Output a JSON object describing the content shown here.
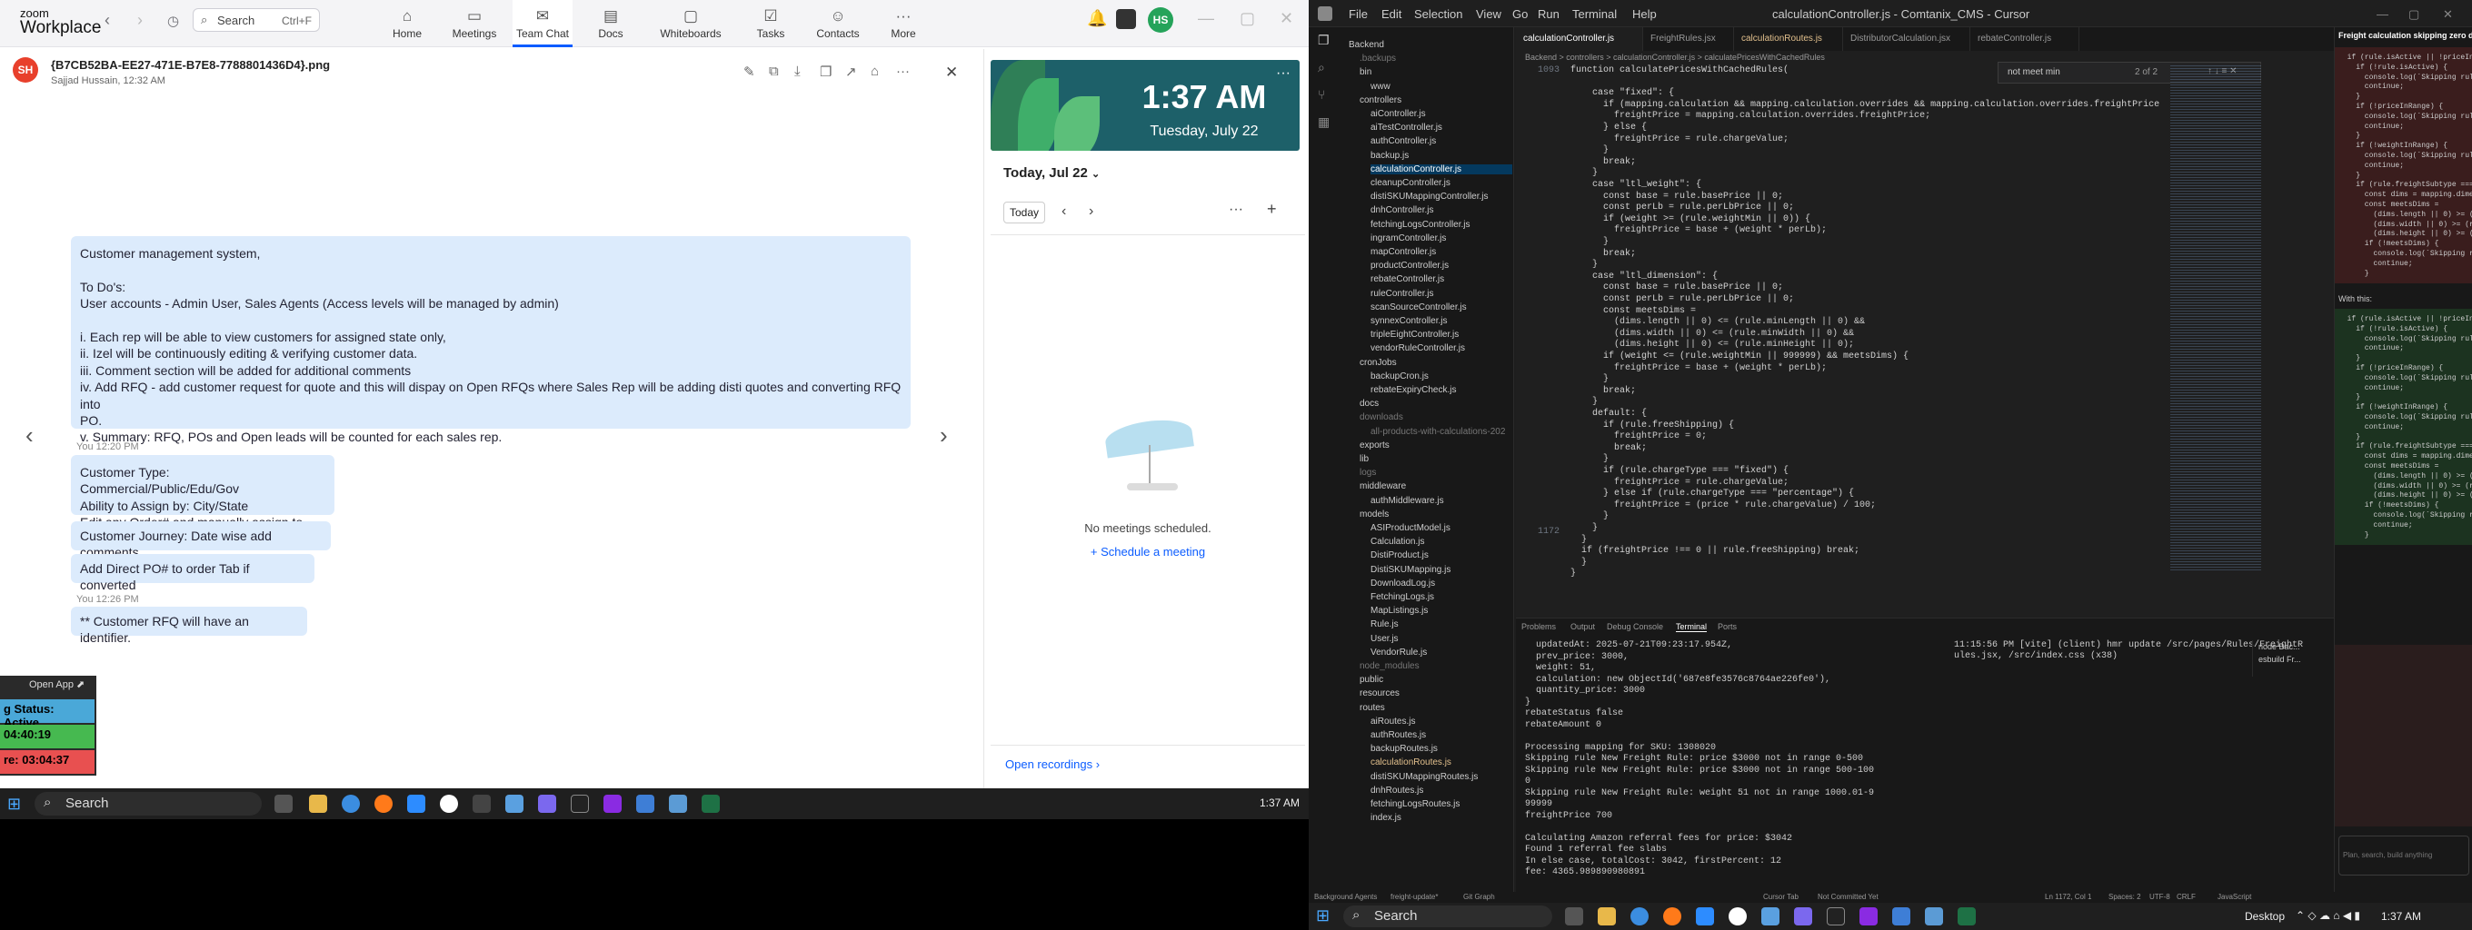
{
  "zoom": {
    "logo_top": "zoom",
    "logo_bottom": "Workplace",
    "search_placeholder": "Search",
    "search_shortcut": "Ctrl+F",
    "tabs": [
      {
        "label": "Home",
        "icon": "home-icon"
      },
      {
        "label": "Meetings",
        "icon": "video-icon"
      },
      {
        "label": "Team Chat",
        "icon": "chat-icon"
      },
      {
        "label": "Docs",
        "icon": "doc-icon"
      },
      {
        "label": "Whiteboards",
        "icon": "whiteboard-icon"
      },
      {
        "label": "Tasks",
        "icon": "tasks-icon"
      },
      {
        "label": "Contacts",
        "icon": "contacts-icon"
      },
      {
        "label": "More",
        "icon": "more-icon"
      }
    ],
    "active_tab": "Team Chat",
    "user_initials": "HS"
  },
  "file_viewer": {
    "sender_initials": "SH",
    "file_name": "{B7CB52BA-EE27-471E-B7E8-7788801436D4}.png",
    "subtitle": "Sajjad Hussain, 12:32 AM"
  },
  "messages": {
    "main_lines": [
      "Customer management system,",
      "",
      "To Do's:",
      "User accounts - Admin User, Sales Agents (Access levels will be managed by admin)",
      "",
      "i. Each rep will be able to view customers for assigned state only,",
      "ii. Izel will be continuously editing & verifying customer data.",
      "iii. Comment section will be added for additional comments",
      "iv. Add RFQ - add customer request for quote and this will dispay on Open RFQs where Sales Rep will be adding disti quotes and converting RFQ into",
      "PO.",
      "v. Summary: RFQ, POs and Open leads will be counted for each sales rep."
    ],
    "meta1": "You 12:20 PM",
    "block2": [
      "Customer Type: Commercial/Public/Edu/Gov",
      "Ability to Assign by: City/State",
      "Edit any Order# and manually assign to Rep"
    ],
    "single1": "Customer Journey: Date wise add comments",
    "single2": "Add Direct PO# to order Tab if converted",
    "meta2": "You 12:26 PM",
    "single3": "** Customer RFQ will have an identifier."
  },
  "calendar": {
    "time": "1:37 AM",
    "date": "Tuesday, July 22",
    "today_label": "Today, Jul 22",
    "today_button": "Today",
    "empty_text": "No meetings scheduled.",
    "schedule_link": "Schedule a meeting",
    "recordings_link": "Open recordings"
  },
  "status_widget": {
    "open_app": "Open App",
    "status": "g Status: Active",
    "timer1": "04:40:19",
    "timer2": "re: 03:04:37"
  },
  "taskbar_left": {
    "search": "Search",
    "time": "1:37 AM"
  },
  "vscode": {
    "menus": [
      "File",
      "Edit",
      "Selection",
      "View",
      "Go",
      "Run",
      "Terminal",
      "Help"
    ],
    "window_title": "calculationController.js - Comtanix_CMS - Cursor",
    "tabs": [
      "calculationController.js",
      "FreightRules.jsx",
      "calculationRoutes.js",
      "DistributorCalculation.jsx",
      "rebateController.js"
    ],
    "breadcrumb": "Backend > controllers > calculationController.js > calculatePricesWithCachedRules",
    "find_text": "not meet min",
    "find_count": "2 of 2",
    "explorer": [
      {
        "t": "Backend",
        "d": 0,
        "c": "folder"
      },
      {
        "t": ".backups",
        "d": 1,
        "c": "dim"
      },
      {
        "t": "bin",
        "d": 1,
        "c": ""
      },
      {
        "t": "www",
        "d": 2,
        "c": ""
      },
      {
        "t": "controllers",
        "d": 1,
        "c": ""
      },
      {
        "t": "aiController.js",
        "d": 2,
        "c": ""
      },
      {
        "t": "aiTestController.js",
        "d": 2,
        "c": ""
      },
      {
        "t": "authController.js",
        "d": 2,
        "c": ""
      },
      {
        "t": "backup.js",
        "d": 2,
        "c": ""
      },
      {
        "t": "calculationController.js",
        "d": 2,
        "c": "sel"
      },
      {
        "t": "cleanupController.js",
        "d": 2,
        "c": ""
      },
      {
        "t": "distiSKUMappingController.js",
        "d": 2,
        "c": ""
      },
      {
        "t": "dnhController.js",
        "d": 2,
        "c": ""
      },
      {
        "t": "fetchingLogsController.js",
        "d": 2,
        "c": ""
      },
      {
        "t": "ingramController.js",
        "d": 2,
        "c": ""
      },
      {
        "t": "mapController.js",
        "d": 2,
        "c": ""
      },
      {
        "t": "productController.js",
        "d": 2,
        "c": ""
      },
      {
        "t": "rebateController.js",
        "d": 2,
        "c": ""
      },
      {
        "t": "ruleController.js",
        "d": 2,
        "c": ""
      },
      {
        "t": "scanSourceController.js",
        "d": 2,
        "c": ""
      },
      {
        "t": "synnexController.js",
        "d": 2,
        "c": ""
      },
      {
        "t": "tripleEightController.js",
        "d": 2,
        "c": ""
      },
      {
        "t": "vendorRuleController.js",
        "d": 2,
        "c": ""
      },
      {
        "t": "cronJobs",
        "d": 1,
        "c": ""
      },
      {
        "t": "backupCron.js",
        "d": 2,
        "c": ""
      },
      {
        "t": "rebateExpiryCheck.js",
        "d": 2,
        "c": ""
      },
      {
        "t": "docs",
        "d": 1,
        "c": ""
      },
      {
        "t": "downloads",
        "d": 1,
        "c": "dim"
      },
      {
        "t": "all-products-with-calculations-202",
        "d": 2,
        "c": "dim"
      },
      {
        "t": "exports",
        "d": 1,
        "c": ""
      },
      {
        "t": "lib",
        "d": 1,
        "c": ""
      },
      {
        "t": "logs",
        "d": 1,
        "c": "dim"
      },
      {
        "t": "middleware",
        "d": 1,
        "c": ""
      },
      {
        "t": "authMiddleware.js",
        "d": 2,
        "c": ""
      },
      {
        "t": "models",
        "d": 1,
        "c": ""
      },
      {
        "t": "ASIProductModel.js",
        "d": 2,
        "c": ""
      },
      {
        "t": "Calculation.js",
        "d": 2,
        "c": ""
      },
      {
        "t": "DistiProduct.js",
        "d": 2,
        "c": ""
      },
      {
        "t": "DistiSKUMapping.js",
        "d": 2,
        "c": ""
      },
      {
        "t": "DownloadLog.js",
        "d": 2,
        "c": ""
      },
      {
        "t": "FetchingLogs.js",
        "d": 2,
        "c": ""
      },
      {
        "t": "MapListings.js",
        "d": 2,
        "c": ""
      },
      {
        "t": "Rule.js",
        "d": 2,
        "c": ""
      },
      {
        "t": "User.js",
        "d": 2,
        "c": ""
      },
      {
        "t": "VendorRule.js",
        "d": 2,
        "c": ""
      },
      {
        "t": "node_modules",
        "d": 1,
        "c": "dim"
      },
      {
        "t": "public",
        "d": 1,
        "c": ""
      },
      {
        "t": "resources",
        "d": 1,
        "c": ""
      },
      {
        "t": "routes",
        "d": 1,
        "c": ""
      },
      {
        "t": "aiRoutes.js",
        "d": 2,
        "c": ""
      },
      {
        "t": "authRoutes.js",
        "d": 2,
        "c": ""
      },
      {
        "t": "backupRoutes.js",
        "d": 2,
        "c": ""
      },
      {
        "t": "calculationRoutes.js",
        "d": 2,
        "c": "mod"
      },
      {
        "t": "distiSKUMappingRoutes.js",
        "d": 2,
        "c": ""
      },
      {
        "t": "dnhRoutes.js",
        "d": 2,
        "c": ""
      },
      {
        "t": "fetchingLogsRoutes.js",
        "d": 2,
        "c": ""
      },
      {
        "t": "index.js",
        "d": 2,
        "c": ""
      }
    ],
    "line_numbers": [
      "1093",
      "",
      "",
      "",
      "",
      "",
      "",
      "",
      "",
      "",
      "",
      "",
      "",
      "",
      "",
      "",
      "",
      "",
      "",
      "",
      "",
      "",
      "",
      "",
      "",
      "",
      "",
      "",
      "",
      "",
      "",
      "",
      "",
      "",
      "",
      "",
      "",
      "",
      "",
      "",
      "",
      "",
      "",
      "",
      "",
      "",
      "",
      "",
      "",
      "",
      "",
      "",
      "",
      "1172"
    ],
    "code": [
      "function calculatePricesWithCachedRules(",
      "",
      "    case \"fixed\": {",
      "      if (mapping.calculation && mapping.calculation.overrides && mapping.calculation.overrides.freightPrice",
      "        freightPrice = mapping.calculation.overrides.freightPrice;",
      "      } else {",
      "        freightPrice = rule.chargeValue;",
      "      }",
      "      break;",
      "    }",
      "    case \"ltl_weight\": {",
      "      const base = rule.basePrice || 0;",
      "      const perLb = rule.perLbPrice || 0;",
      "      if (weight >= (rule.weightMin || 0)) {",
      "        freightPrice = base + (weight * perLb);",
      "      }",
      "      break;",
      "    }",
      "    case \"ltl_dimension\": {",
      "      const base = rule.basePrice || 0;",
      "      const perLb = rule.perLbPrice || 0;",
      "      const meetsDims =",
      "        (dims.length || 0) <= (rule.minLength || 0) &&",
      "        (dims.width || 0) <= (rule.minWidth || 0) &&",
      "        (dims.height || 0) <= (rule.minHeight || 0);",
      "      if (weight <= (rule.weightMin || 999999) && meetsDims) {",
      "        freightPrice = base + (weight * perLb);",
      "      }",
      "      break;",
      "    }",
      "    default: {",
      "      if (rule.freeShipping) {",
      "        freightPrice = 0;",
      "        break;",
      "      }",
      "      if (rule.chargeType === \"fixed\") {",
      "        freightPrice = rule.chargeValue;",
      "      } else if (rule.chargeType === \"percentage\") {",
      "        freightPrice = (price * rule.chargeValue) / 100;",
      "      }",
      "    }",
      "  }",
      "  if (freightPrice !== 0 || rule.freeShipping) break;",
      "  }",
      "}"
    ],
    "panel_tabs": [
      "Problems",
      "Output",
      "Debug Console",
      "Terminal",
      "Ports"
    ],
    "terminal": [
      "  updatedAt: 2025-07-21T09:23:17.954Z,",
      "  prev_price: 3000,",
      "  weight: 51,",
      "  calculation: new ObjectId('687e8fe3576c8764ae226fe0'),",
      "  quantity_price: 3000",
      "}",
      "rebateStatus false",
      "rebateAmount 0",
      "",
      "Processing mapping for SKU: 1308020",
      "Skipping rule New Freight Rule: price $3000 not in range 0-500",
      "Skipping rule New Freight Rule: price $3000 not in range 500-100",
      "0",
      "Skipping rule New Freight Rule: weight 51 not in range 1000.01-9",
      "99999",
      "freightPrice 700",
      "",
      "Calculating Amazon referral fees for price: $3042",
      "Found 1 referral fee slabs",
      "In else case, totalCost: 3042, firstPercent: 12",
      "fee: 4365.989890980891"
    ],
    "terminal2": [
      "11:15:56 PM [vite] (client) hmr update /src/pages/Rules/FreightR",
      "ules.jsx, /src/index.css (x38)"
    ],
    "term_list": [
      "node Bac...",
      "esbuild Fr..."
    ],
    "chat_title": "Freight calculation skipping zero doll",
    "with_this": "With this:",
    "diff_lines": [
      "  if (rule.isActive || !priceInRange || !weightInRange)",
      "    if (!rule.isActive) {",
      "      console.log(`Skipping rule ${rule.ruleName}: not act",
      "      continue;",
      "    }",
      "    if (!priceInRange) {",
      "      console.log(`Skipping rule ${rule.ruleName}: price $",
      "      continue;",
      "    }",
      "    if (!weightInRange) {",
      "      console.log(`Skipping rule ${rule.ruleName}: weight",
      "      continue;",
      "    }",
      "    if (rule.freightSubtype === \"ltl_dimension\") {",
      "      const dims = mapping.dimensions || {};",
      "      const meetsDims =",
      "        (dims.length || 0) >= (rule.minLength || 0) &&",
      "        (dims.width || 0) >= (rule.minWidth || 0) &&",
      "        (dims.height || 0) >= (rule.minHeight || 0);",
      "      if (!meetsDims) {",
      "        console.log(`Skipping rule ${rule.ruleName}: dimen",
      "        continue;",
      "      }"
    ],
    "input_placeholder": "Plan, search, build anything",
    "status_items": [
      "Background Agents",
      "freight-update*",
      "Git Graph",
      "Cursor Tab",
      "Not Committed Yet",
      "Ln 1172, Col 1",
      "Spaces: 2",
      "UTF-8",
      "CRLF",
      "JavaScript"
    ],
    "taskbar_search": "Search",
    "taskbar_time": "1:37 AM",
    "taskbar_desktop": "Desktop"
  },
  "colors": {
    "zoom_blue": "#0b5cff",
    "bubble": "#dcebfc",
    "clock_bg": "#1d6069",
    "status_green": "#3fb950",
    "status_red": "#e85050"
  }
}
